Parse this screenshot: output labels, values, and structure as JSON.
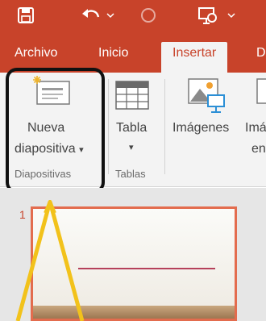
{
  "quick_access": {
    "icons": [
      "save-icon",
      "undo-icon",
      "redo-icon",
      "presentation-start-icon"
    ]
  },
  "tabs": [
    {
      "label": "Archivo",
      "active": false
    },
    {
      "label": "Inicio",
      "active": false
    },
    {
      "label": "Insertar",
      "active": true
    },
    {
      "label": "D",
      "active": false
    }
  ],
  "ribbon": {
    "nueva_diapositiva": {
      "line1": "Nueva",
      "line2": "diapositiva",
      "caret": "▾"
    },
    "tabla": {
      "label": "Tabla",
      "caret": "▾"
    },
    "imagenes": {
      "label": "Imágenes"
    },
    "imagenes_linea": {
      "line1": "Imá",
      "line2": "en"
    },
    "groups": {
      "diapositivas": "Diapositivas",
      "tablas": "Tablas"
    }
  },
  "slide_pane": {
    "slide_number": "1"
  },
  "colors": {
    "accent": "#c8432a",
    "ribbon_bg": "#f3f3f3",
    "highlight_border": "#111111",
    "annotation_arrow": "#f2c21b",
    "slide_border": "#e36c4e"
  }
}
